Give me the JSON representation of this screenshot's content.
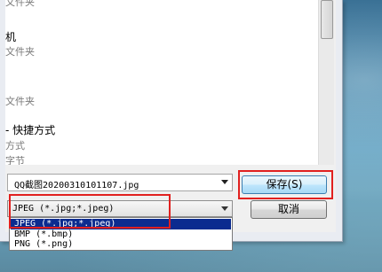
{
  "file_list": {
    "items": [
      {
        "text": "文件夹",
        "style": "sub"
      },
      {
        "text": "机",
        "style": "main"
      },
      {
        "text": "文件夹",
        "style": "sub"
      },
      {
        "text": "文件夹",
        "style": "sub"
      },
      {
        "text": "- 快捷方式",
        "style": "main"
      },
      {
        "text": "方式",
        "style": "sub"
      },
      {
        "text": "字节",
        "style": "sub"
      }
    ]
  },
  "form": {
    "filename_value": "QQ截图20200310101107.jpg",
    "filetype_selected": "JPEG (*.jpg;*.jpeg)",
    "filetype_options": [
      "JPEG (*.jpg;*.jpeg)",
      "BMP (*.bmp)",
      "PNG (*.png)"
    ]
  },
  "buttons": {
    "save": "保存(S)",
    "cancel": "取消"
  },
  "colors": {
    "highlight": "#e1201f",
    "selected_option": "#0b2b8f"
  },
  "icons": [
    "dropdown-arrow-icon"
  ]
}
